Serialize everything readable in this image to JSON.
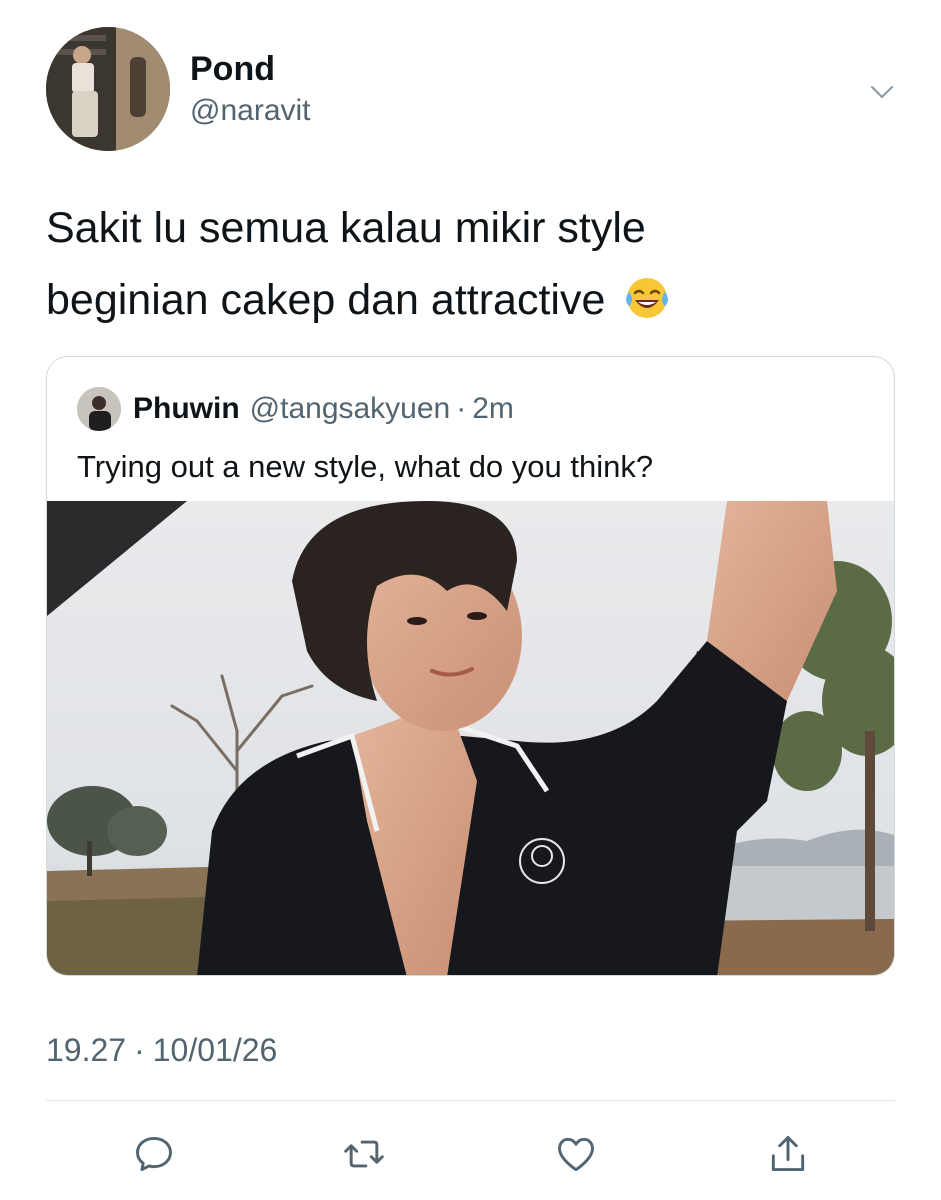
{
  "tweet": {
    "author": {
      "name": "Pond",
      "handle": "@naravit"
    },
    "text_line1": "Sakit lu semua kalau mikir style",
    "text_line2": "beginian cakep dan attractive",
    "emoji": "face-with-tears-of-joy",
    "timestamp": {
      "time": "19.27",
      "separator": "·",
      "date": "10/01/26"
    }
  },
  "quote": {
    "name": "Phuwin",
    "handle": "@tangsakyuen",
    "separator": "·",
    "time": "2m",
    "text": "Trying out a new style, what do you think?",
    "media": "photo-person-black-polo-shirt-outdoor"
  },
  "actions": [
    {
      "name": "reply",
      "icon": "speech-bubble-icon"
    },
    {
      "name": "retweet",
      "icon": "retweet-icon"
    },
    {
      "name": "like",
      "icon": "heart-icon"
    },
    {
      "name": "share",
      "icon": "share-icon"
    }
  ],
  "colors": {
    "text": "#0f1419",
    "secondary": "#536471",
    "border": "#cfd9de",
    "icon": "#536471"
  }
}
